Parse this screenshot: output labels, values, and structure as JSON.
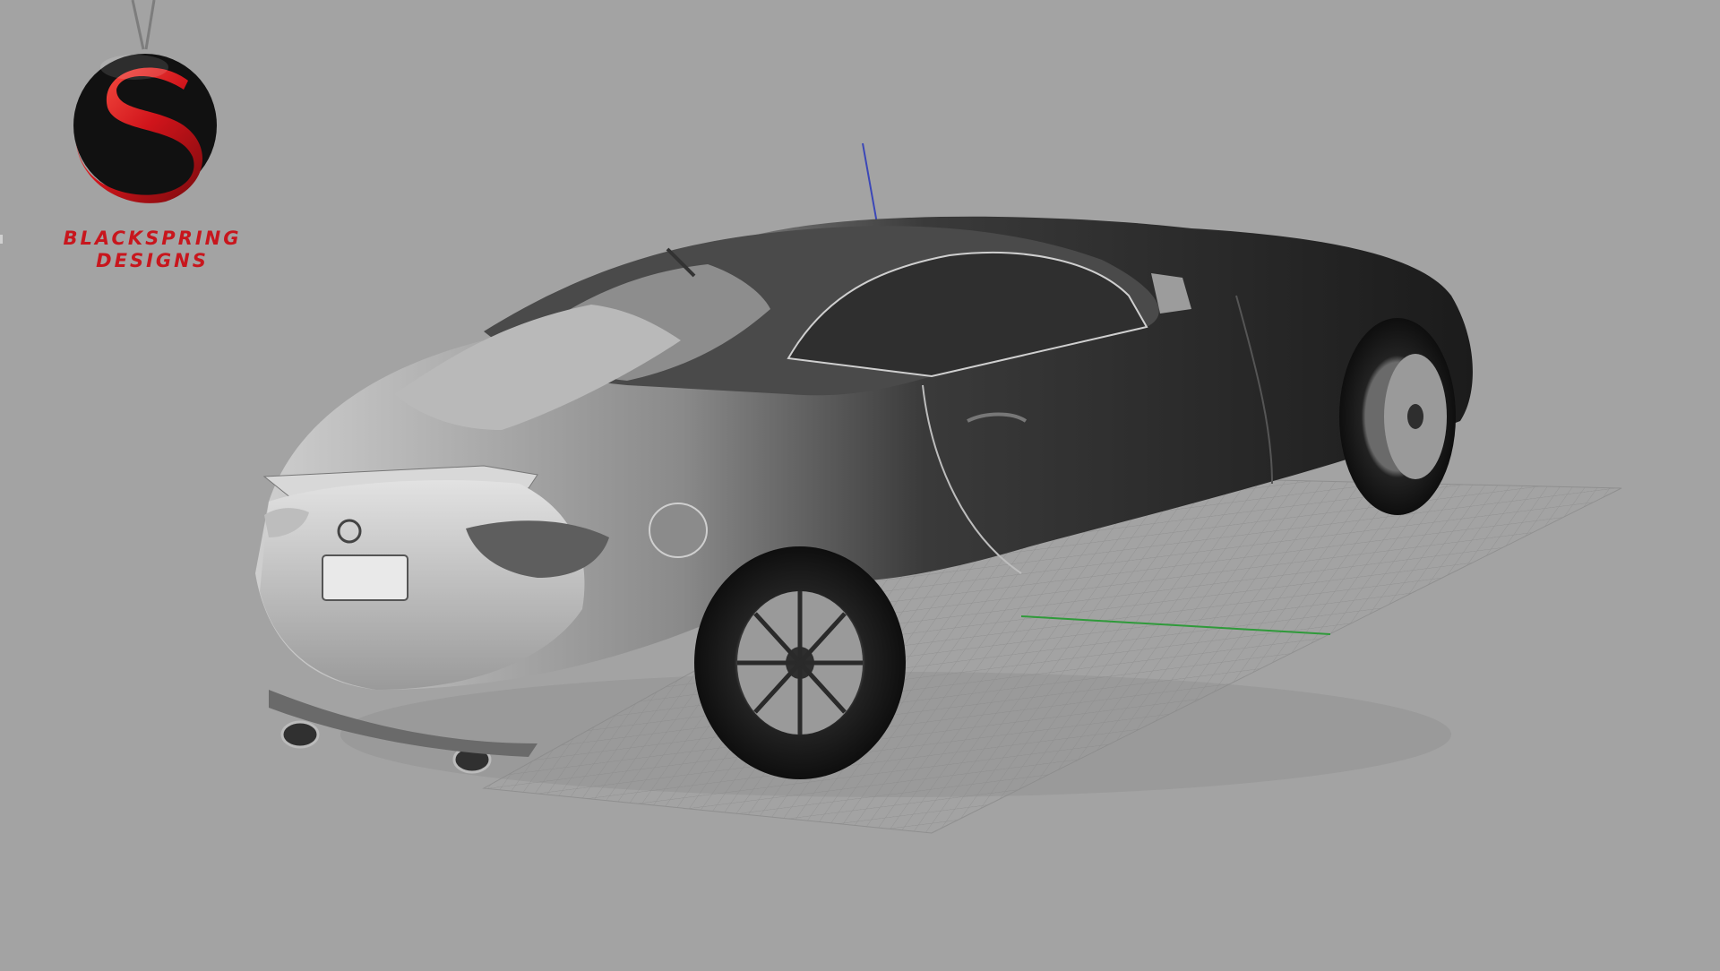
{
  "brand": {
    "line1": "BLACKSPRING",
    "line2": "DESIGNS",
    "accent_color": "#c8161d"
  },
  "scene": {
    "background_color": "#a3a3a3",
    "object": "car-model",
    "axes": [
      "x-axis",
      "y-axis",
      "z-axis"
    ],
    "ground_grid": "ground-grid"
  }
}
